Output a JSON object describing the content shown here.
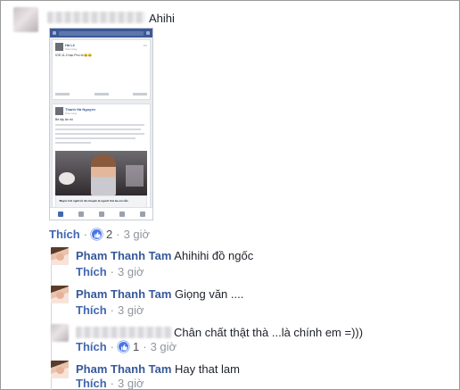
{
  "main_comment": {
    "text": "Ahihi",
    "like_label": "Thích",
    "reaction_count": "2",
    "timestamp": "3 giờ"
  },
  "embedded_screenshot": {
    "post1_author": "Hà Lê",
    "post1_meta": "Vừa xong",
    "post1_text": "IOS 11.2 hạo Pm rồi 😂😂",
    "post2_author": "Thanh Hà Nguyen",
    "post2_meta": "Vừa xong",
    "post2_text": "Bé tây ăn rồi",
    "link_title": "'Mayor bởi ngữi tối độ chuyện lộ người thứ ba em vẫn"
  },
  "replies": [
    {
      "author": "Pham Thanh Tam",
      "text": "Ahihihi đồ ngốc",
      "like_label": "Thích",
      "timestamp": "3 giờ",
      "reaction_count": ""
    },
    {
      "author": "Pham Thanh Tam",
      "text": "Giọng văn ....",
      "like_label": "Thích",
      "timestamp": "3 giờ",
      "reaction_count": ""
    },
    {
      "author": "",
      "text": "Chân chất thật thà ...là chính em =)))",
      "like_label": "Thích",
      "timestamp": "3 giờ",
      "reaction_count": "1"
    },
    {
      "author": "Pham Thanh Tam",
      "text": "Hay that lam",
      "like_label": "Thích",
      "timestamp": "3 giờ",
      "reaction_count": ""
    }
  ],
  "separator": "·",
  "colors": {
    "link_blue": "#4267b2",
    "author_blue": "#365899",
    "meta_gray": "#90949c",
    "like_icon": "#4a76e8"
  }
}
